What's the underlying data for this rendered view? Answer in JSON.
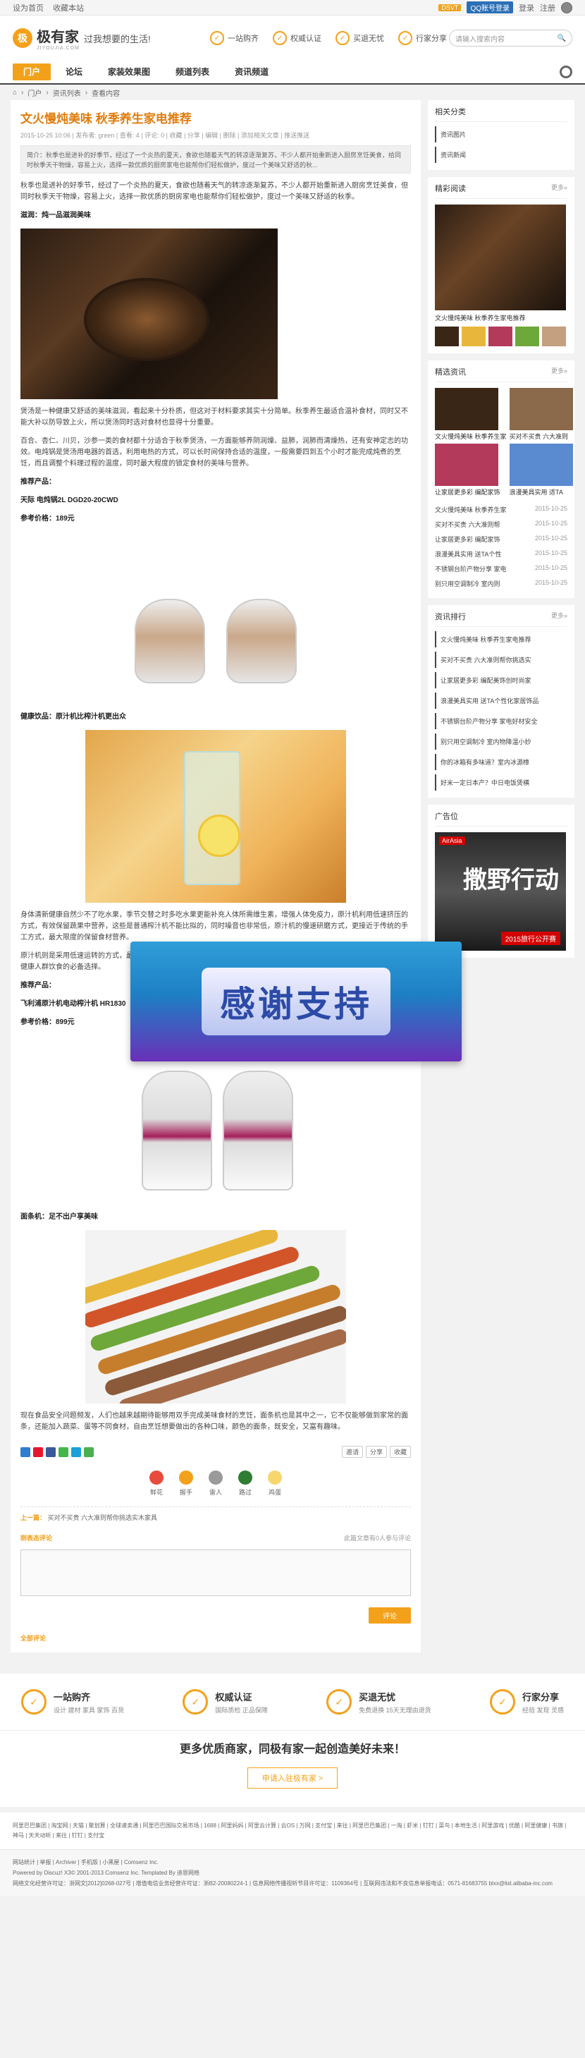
{
  "topbar": {
    "links": [
      "设为首页",
      "收藏本站"
    ],
    "dsvt": "DSVT",
    "qq": "QQ账号登录",
    "login": "登录",
    "register": "注册"
  },
  "header": {
    "logo_mark": "极",
    "logo_name": "极有家",
    "logo_sub": "JIYOUJIA.COM",
    "slogan": "过我想要的生活!",
    "features": [
      {
        "label": "一站购齐",
        "icon": "cart-icon"
      },
      {
        "label": "权威认证",
        "icon": "badge-icon"
      },
      {
        "label": "买退无忧",
        "icon": "thumb-icon"
      },
      {
        "label": "行家分享",
        "icon": "share-icon"
      }
    ],
    "search_placeholder": "请输入搜索内容"
  },
  "nav": {
    "items": [
      "门户",
      "论坛",
      "家装效果图",
      "频道列表",
      "资讯频道"
    ]
  },
  "breadcrumb": [
    "门户",
    "资讯列表",
    "查看内容"
  ],
  "article": {
    "title": "文火慢炖美味 秋季养生家电推荐",
    "meta": "2015-10-25 10:06 | 发布者: green | 查看: 4 | 评论: 0 | 收藏 | 分享 | 编辑 | 删除 | 添加相关文章 | 推送推送",
    "summary": "简介：秋季也是进补的好季节，经过了一个炎热的夏天，食欲也随着天气的转凉逐渐复苏，不少人都开始重新进入厨房烹饪美食，给同时秋季天干物燥，容易上火，选择一款优质的厨房家电也能帮你们轻松做护，度过一个美味又舒适的秋...",
    "intro": "秋季也是进补的好季节，经过了一个炎热的夏天，食欲也随着天气的转凉逐渐复苏，不少人都开始重新进入厨房烹饪美食，但同时秋季天干物燥，容易上火，选择一款优质的厨房家电也能帮你们轻松做护，度过一个美味又舒适的秋季。",
    "section1": "滋润：炖一品滋润美味",
    "section1_text1": "煲汤是一种健康又舒适的美味滋润，看起来十分朴质，但这对于材料要求其实十分简单。秋季养生最适合温补食材，同时又不能大补以防导致上火，所以煲汤同时选对食材也显得十分重要。",
    "section1_text2": "百合、杏仁、川贝，沙参一类的食材都十分适合于秋季煲汤，一方面能够养阴润燥、益肺，润肺而清燥热，还有安神定志的功效。电炖锅是煲汤用电器的首选，利用电热的方式，可以长时间保持合适的温度，一般需要四到五个小时才能完成炖煮的烹饪，而且调整个料理过程的温度，同时最大程度的锁定食材的美味与营养。",
    "recommend1_label": "推荐产品：",
    "product1_name": "天际 电炖锅2L DGD20-20CWD",
    "price1": "参考价格：189元",
    "section2": "健康饮品：原汁机比榨汁机更出众",
    "section2_text1": "身体清新健康自然少不了吃水果，季节交替之时多吃水果更能补充人体所需维生素，增强人体免疫力，原汁机利用低速挤压的方式，有效保留蔬果中营养，这些是普通榨汁机不能比拟的，同时噪音也非常低，原汁机的慢速研磨方式，更接近于传统的手工方式，最大限度的保留食材营养。",
    "section2_text2": "原汁机则是采用低速运转的方式，最大程度保留蔬果中的营养，在口感上也比较好，而且原汁机通常可以有三种不同功能，是健康人群饮食的必备选择。",
    "recommend2_label": "推荐产品：",
    "product2_name": "飞利浦原汁机电动榨汁机 HR1830",
    "price2": "参考价格：899元",
    "section3": "面条机：足不出户享美味",
    "section3_text": "现在食品安全问题频发，人们也越来越期待能够用双手完成美味食材的烹饪，面条机也是其中之一，它不仅能够做到家常的面条，还能加入蔬菜、蛋等不同食材，自由烹饪想要做出的各种口味，颜色的面条，既安全，又富有趣味。",
    "share_buttons": [
      "邀请",
      "分享",
      "收藏"
    ],
    "moods": [
      "鲜花",
      "握手",
      "雷人",
      "路过",
      "鸡蛋"
    ],
    "prev": "上一篇：",
    "prev_title": "买对不买贵 六大准则帮你挑选实木家具",
    "comment_title": "刚表态评论",
    "comment_right": "此篇文章有0人参与评论",
    "submit": "评论",
    "all_comments": "全部评论"
  },
  "sidebar": {
    "related_title": "相关分类",
    "related": [
      "资讯图片",
      "资讯新闻"
    ],
    "hot_title": "精彩阅读",
    "more": "更多»",
    "hot_caption": "文火慢炖美味 秋季养生家电推荐",
    "picks_title": "精选资讯",
    "picks_caps": [
      "文火慢炖美味 秋季养生家",
      "买对不买贵 六大准则",
      "让家居更多彩 编配家饰",
      "浪漫美具实用 适TA"
    ],
    "picks_list": [
      {
        "t": "文火慢炖美味 秋季养生家",
        "d": "2015-10-25"
      },
      {
        "t": "买对不买贵 六大准则帮",
        "d": "2015-10-25"
      },
      {
        "t": "让家居更多彩 编配家饰",
        "d": "2015-10-25"
      },
      {
        "t": "浪漫美具实用 送TA个性",
        "d": "2015-10-25"
      },
      {
        "t": "不锈钢台阶产物分享 家电",
        "d": "2015-10-25"
      },
      {
        "t": "别只用空调制冷 室内则",
        "d": "2015-10-25"
      }
    ],
    "rank_title": "资讯排行",
    "rank": [
      "文火慢炖美味 秋季养生家电推荐",
      "买对不买贵 六大准则帮你挑选实",
      "让家居更多彩 编配美饰创时尚家",
      "浪漫美具实用 送TA个性化家居饰品",
      "不锈钢台阶产物分享 家电好材安全",
      "别只用空调制冷 室内物降温小妙",
      "你的冰箱有多味道？室内冰源樟",
      "好米一定日本产？中日电饭煲横"
    ],
    "ad_title": "广告位",
    "ad_brand": "AirAsia",
    "ad_big": "撒野行动",
    "ad_foot": "2015旅行公开赛"
  },
  "overlay": {
    "text": "感谢支持"
  },
  "footer": {
    "features": [
      {
        "t": "一站购齐",
        "s": "设计 建材 家具 家饰 百货",
        "icon": "cart-icon"
      },
      {
        "t": "权威认证",
        "s": "国际质检 正品保障",
        "icon": "badge-icon"
      },
      {
        "t": "买退无忧",
        "s": "免费退换 15天无理由退货",
        "icon": "thumb-icon"
      },
      {
        "t": "行家分享",
        "s": "经验 发现 灵感",
        "icon": "share-icon"
      }
    ],
    "slogan": "更多优质商家，同极有家一起创造美好未来！",
    "join": "申请入驻极有家 >",
    "links": "阿里巴巴集团 | 淘宝网 | 天猫 | 聚划算 | 全球速卖通 | 阿里巴巴国际交易市场 | 1688 | 阿里妈妈 | 阿里云计算 | 云OS | 万网 | 支付宝 | 来往 | 阿里巴巴集团 | 一淘 | 虾米 | 钉钉 | 菜鸟 | 本地生活 | 阿里游戏 | 优酷 | 阿里健康 | 书旗 | 神马 | 天天动听 | 来往 | 钉钉 | 支付宝",
    "bottom1": "网站统计 | 举报 | Archiver | 手机版 | 小黑屋 | Comsenz Inc.",
    "bottom2": "Powered by Discuz! X3© 2001-2013 Comsenz Inc. Templated By 迪恩网络",
    "bottom3": "网络文化经营许可证：浙网文[2012]0268-027号 | 增值电信业务经营许可证：浙B2-20080224-1 | 信息网络传播视听节目许可证：1109364号 | 互联网违法和不良信息举报电话：0571-81683755 blxx@list.alibaba-inc.com"
  }
}
